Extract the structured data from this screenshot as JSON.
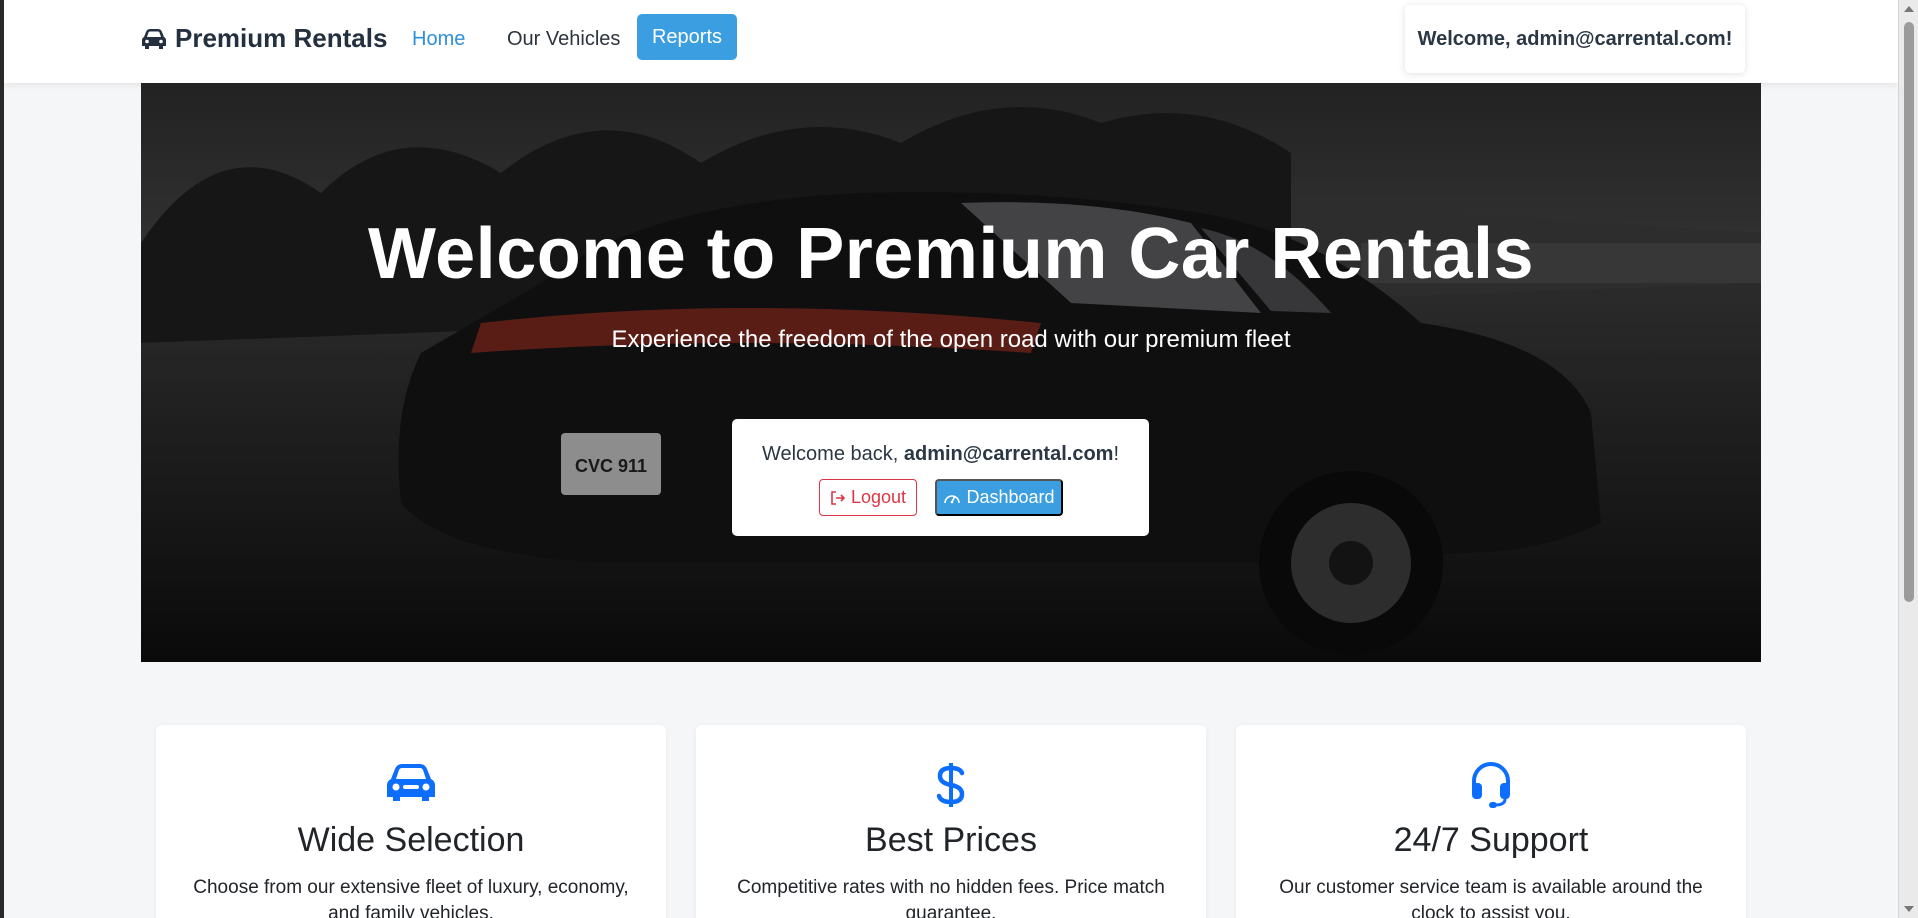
{
  "nav": {
    "brand": "Premium Rentals",
    "links": [
      "Home",
      "Our Vehicles",
      "Reports"
    ],
    "welcome": "Welcome, admin@carrental.com!"
  },
  "hero": {
    "title": "Welcome to Premium Car Rentals",
    "subtitle": "Experience the freedom of the open road with our premium fleet",
    "plate_text": "CVC 911",
    "welcome_prefix": "Welcome back, ",
    "welcome_user": "admin@carrental.com",
    "welcome_suffix": "!",
    "logout_label": "Logout",
    "dashboard_label": "Dashboard"
  },
  "features": [
    {
      "icon": "car-front-icon",
      "title": "Wide Selection",
      "description": "Choose from our extensive fleet of luxury, economy, and family vehicles."
    },
    {
      "icon": "dollar-icon",
      "title": "Best Prices",
      "description": "Competitive rates with no hidden fees. Price match guarantee."
    },
    {
      "icon": "headset-icon",
      "title": "24/7 Support",
      "description": "Our customer service team is available around the clock to assist you."
    }
  ],
  "colors": {
    "accent": "#3a9ee0",
    "link_active": "#2f8fd8",
    "danger": "#dc3545",
    "feature_icon": "#0d6efd"
  }
}
